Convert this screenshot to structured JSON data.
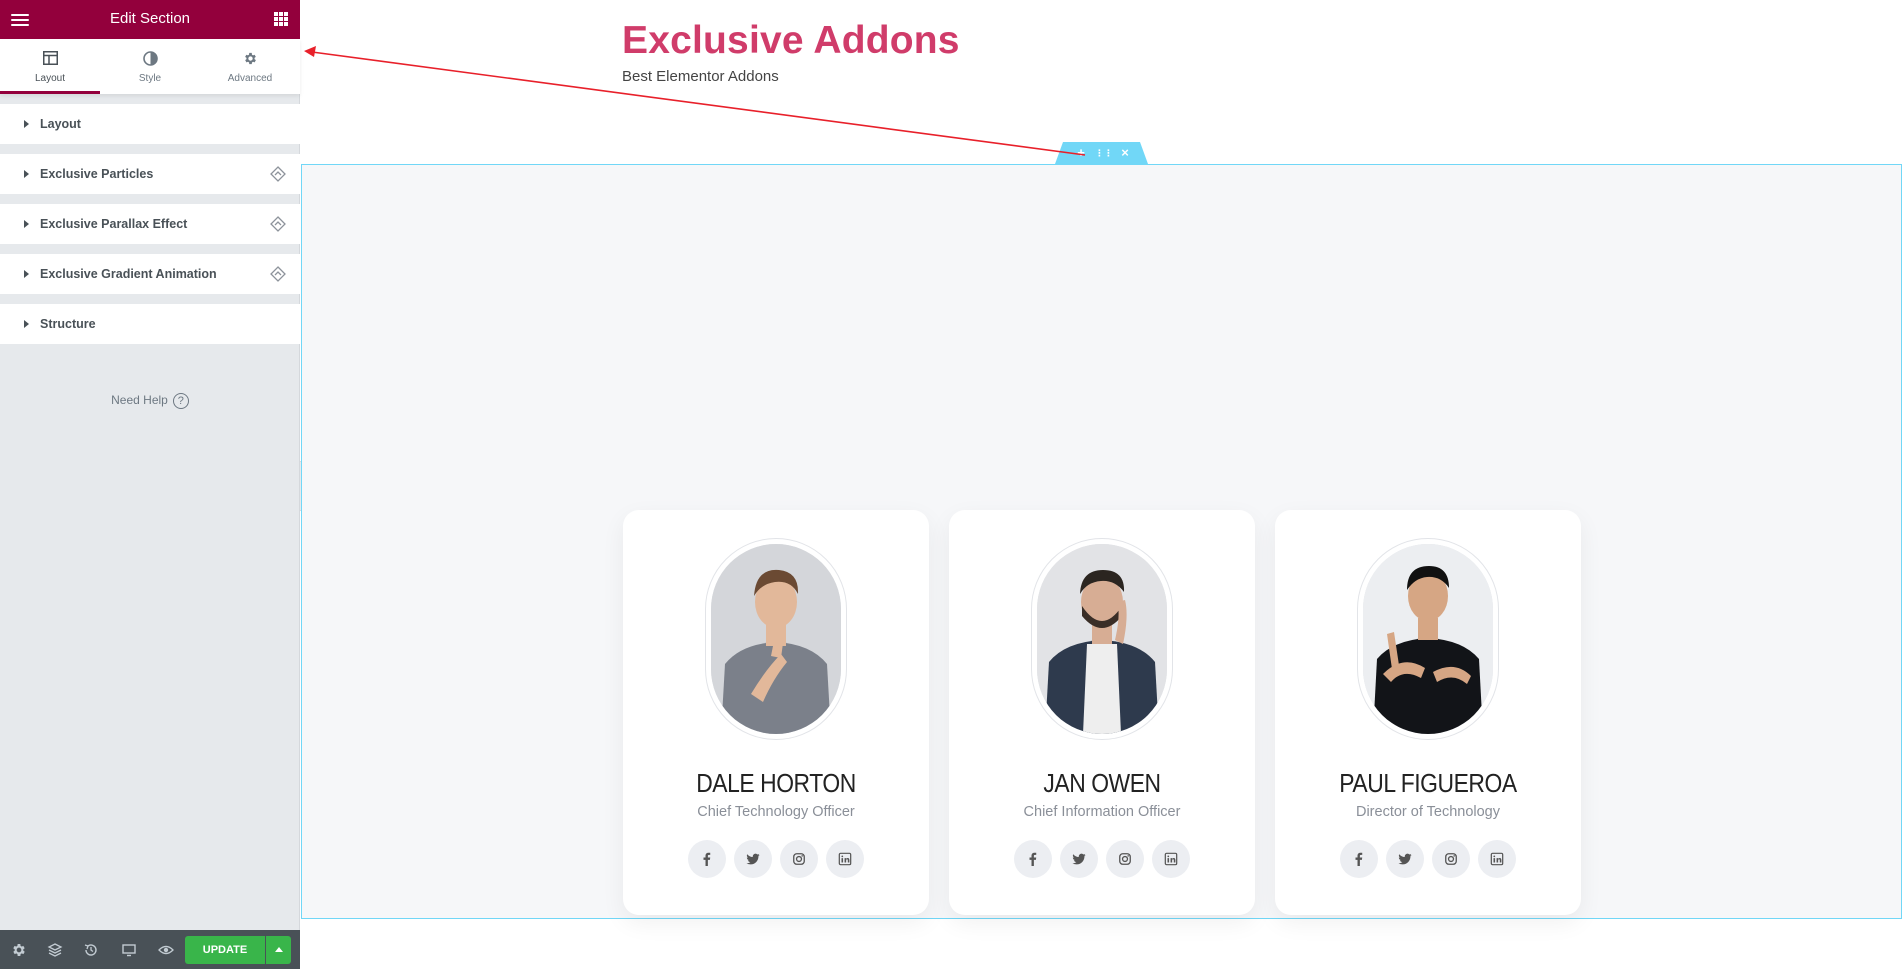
{
  "editor": {
    "title": "Edit Section",
    "tabs": [
      {
        "label": "Layout",
        "icon": "layout-icon"
      },
      {
        "label": "Style",
        "icon": "contrast-icon"
      },
      {
        "label": "Advanced",
        "icon": "gear-icon"
      }
    ],
    "sections": [
      {
        "label": "Layout",
        "has_ea_icon": false
      },
      {
        "label": "Exclusive Particles",
        "has_ea_icon": true
      },
      {
        "label": "Exclusive Parallax Effect",
        "has_ea_icon": true
      },
      {
        "label": "Exclusive Gradient Animation",
        "has_ea_icon": true
      },
      {
        "label": "Structure",
        "has_ea_icon": false
      }
    ],
    "need_help": "Need Help",
    "help_glyph": "?",
    "update_label": "UPDATE"
  },
  "page": {
    "title": "Exclusive Addons",
    "subtitle": "Best Elementor Addons"
  },
  "section_handle": {
    "add": "+",
    "move": "⋮⋮",
    "close": "×"
  },
  "team": [
    {
      "name": "DALE HORTON",
      "role": "Chief Technology Officer",
      "shirt": "#7b808a",
      "hair": "#6b4a33",
      "skin": "#e2b89a"
    },
    {
      "name": "JAN OWEN",
      "role": "Chief Information Officer",
      "shirt": "#2e3a4d",
      "hair": "#2b2520",
      "skin": "#d7ad94"
    },
    {
      "name": "PAUL FIGUEROA",
      "role": "Director of Technology",
      "shirt": "#121418",
      "hair": "#111111",
      "skin": "#d6a684"
    }
  ],
  "social_icons": [
    "facebook-icon",
    "twitter-icon",
    "instagram-icon",
    "linkedin-icon"
  ],
  "colors": {
    "brand": "#93003c",
    "heading": "#d03c6a",
    "section_border": "#71d7f7",
    "update_button": "#39b54a",
    "annotation_arrow": "#e8202a"
  }
}
